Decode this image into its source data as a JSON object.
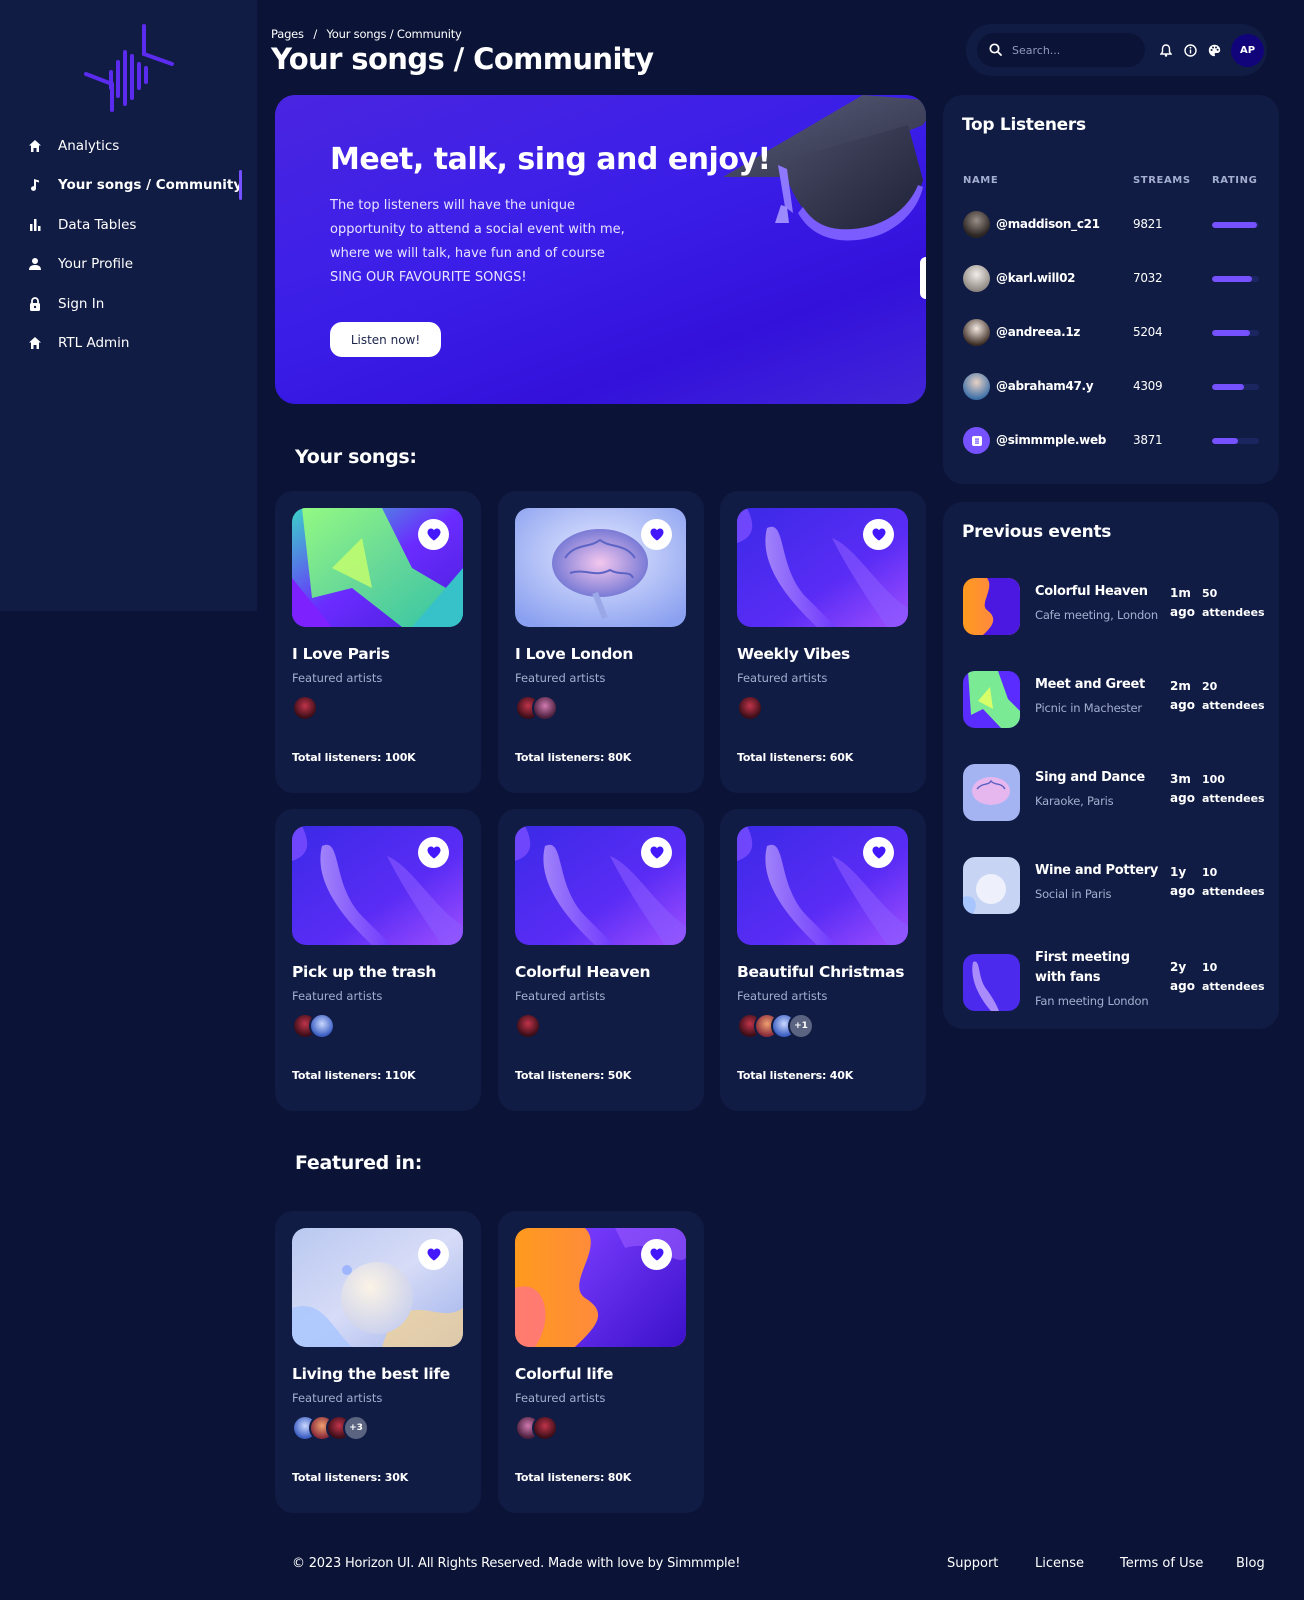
{
  "sidebar": {
    "items": [
      {
        "label": "Analytics",
        "icon": "home-icon"
      },
      {
        "label": "Your songs / Community",
        "icon": "music-note-icon",
        "active": true
      },
      {
        "label": "Data Tables",
        "icon": "bar-chart-icon"
      },
      {
        "label": "Your Profile",
        "icon": "person-icon"
      },
      {
        "label": "Sign In",
        "icon": "lock-icon"
      },
      {
        "label": "RTL Admin",
        "icon": "home-icon"
      }
    ]
  },
  "header": {
    "breadcrumb_root": "Pages",
    "breadcrumb_sep": "/",
    "breadcrumb_current": "Your songs / Community",
    "title": "Your songs / Community",
    "search_placeholder": "Search...",
    "avatar_initials": "AP"
  },
  "banner": {
    "title": "Meet, talk, sing and enjoy!",
    "text": "The top listeners will have the unique opportunity to attend a social event with me, where we will talk, have fun and of course SING OUR FAVOURITE SONGS!",
    "button": "Listen now!"
  },
  "your_songs": {
    "title": "Your songs:",
    "items": [
      {
        "title": "I Love Paris",
        "subtitle": "Featured artists",
        "listeners": "Total listeners: 100K",
        "extra": ""
      },
      {
        "title": "I Love London",
        "subtitle": "Featured artists",
        "listeners": "Total listeners: 80K",
        "extra": ""
      },
      {
        "title": "Weekly Vibes",
        "subtitle": "Featured artists",
        "listeners": "Total listeners: 60K",
        "extra": ""
      },
      {
        "title": "Pick up the trash",
        "subtitle": "Featured artists",
        "listeners": "Total listeners: 110K",
        "extra": ""
      },
      {
        "title": "Colorful Heaven",
        "subtitle": "Featured artists",
        "listeners": "Total listeners: 50K",
        "extra": ""
      },
      {
        "title": "Beautiful Christmas",
        "subtitle": "Featured artists",
        "listeners": "Total listeners: 40K",
        "extra": "+1"
      }
    ]
  },
  "featured": {
    "title": "Featured in:",
    "items": [
      {
        "title": "Living the best life",
        "subtitle": "Featured artists",
        "listeners": "Total listeners: 30K",
        "extra": "+3"
      },
      {
        "title": "Colorful life",
        "subtitle": "Featured artists",
        "listeners": "Total listeners: 80K",
        "extra": ""
      }
    ]
  },
  "top_listeners": {
    "title": "Top Listeners",
    "columns": [
      "NAME",
      "STREAMS",
      "RATING"
    ],
    "rows": [
      {
        "name": "@maddison_c21",
        "streams": "9821",
        "rating": 0.95
      },
      {
        "name": "@karl.will02",
        "streams": "7032",
        "rating": 0.85
      },
      {
        "name": "@andreea.1z",
        "streams": "5204",
        "rating": 0.8
      },
      {
        "name": "@abraham47.y",
        "streams": "4309",
        "rating": 0.68
      },
      {
        "name": "@simmmple.web",
        "streams": "3871",
        "rating": 0.55
      }
    ]
  },
  "previous_events": {
    "title": "Previous events",
    "rows": [
      {
        "title": "Colorful Heaven",
        "subtitle": "Cafe meeting, London",
        "time": "1m ago",
        "attendees": "50 attendees"
      },
      {
        "title": "Meet and Greet",
        "subtitle": "Picnic in Machester",
        "time": "2m ago",
        "attendees": "20 attendees"
      },
      {
        "title": "Sing and Dance",
        "subtitle": "Karaoke, Paris",
        "time": "3m ago",
        "attendees": "100 attendees"
      },
      {
        "title": "Wine and Pottery",
        "subtitle": "Social in Paris",
        "time": "1y ago",
        "attendees": "10 attendees"
      },
      {
        "title": "First meeting with fans",
        "subtitle": "Fan meeting London",
        "time": "2y ago",
        "attendees": "10 attendees"
      }
    ]
  },
  "footer": {
    "copyright": "© 2023 Horizon UI. All Rights Reserved. Made with love by Simmmple!",
    "links": [
      "Support",
      "License",
      "Terms of Use",
      "Blog"
    ]
  },
  "colors": {
    "background": "#0b1437",
    "card": "#111c44",
    "accent": "#7551ff",
    "brand": "#4318ff"
  }
}
